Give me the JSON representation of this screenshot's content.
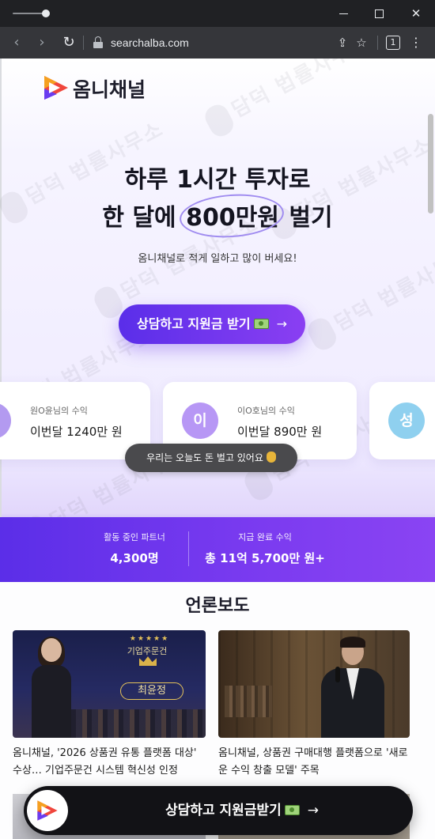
{
  "browser": {
    "url": "searchalba.com",
    "tab_count": "1"
  },
  "brand": {
    "name": "옴니채널"
  },
  "watermark": {
    "text": "담덕 법률사무소"
  },
  "hero": {
    "line1": "하루 1시간 투자로",
    "line2_prefix": "한 달에 ",
    "line2_highlight": "800만원",
    "line2_suffix": " 벌기",
    "subtitle": "옴니채널로 적게 일하고 많이 버세요!",
    "cta_label": "상담하고 지원금 받기",
    "cta_arrow": "→"
  },
  "earnings": [
    {
      "avatar": "",
      "name": "원O윤님의 수익",
      "amount": "이번달 1240만 원"
    },
    {
      "avatar": "이",
      "name": "이O호님의 수익",
      "amount": "이번달 890만 원"
    },
    {
      "avatar": "성",
      "name": "",
      "amount": ""
    }
  ],
  "toast": {
    "text": "우리는 오늘도 돈 벌고 있어요"
  },
  "stats": {
    "partners_label": "활동 중인 파트너",
    "partners_value": "4,300명",
    "paid_label": "지급 완료 수익",
    "paid_value": "총 11억 5,700만 원+"
  },
  "press": {
    "title": "언론보도",
    "items": [
      {
        "caption": "옴니채널, '2026 상품권 유통 플랫폼 대상' 수상… 기업주문건 시스템 혁신성 인정",
        "image_banner": "기업주문건",
        "image_name": "최윤정"
      },
      {
        "caption": "옴니채널, 상품권 구매대행 플랫폼으로 '새로운 수익 창출 모델' 주목"
      }
    ]
  },
  "floating_cta": {
    "label": "상담하고 지원금받기",
    "arrow": "→"
  },
  "colors": {
    "accent_start": "#5a2ee9",
    "accent_end": "#8a3ff2",
    "logo_red": "#f0463c",
    "logo_orange": "#f5a020",
    "logo_purple": "#6a3cf0"
  },
  "icons": {
    "back": "arrow-left-icon",
    "forward": "arrow-right-icon",
    "reload": "reload-icon",
    "lock": "lock-icon",
    "share": "share-icon",
    "bookmark": "star-icon",
    "menu": "more-vert-icon",
    "money": "banknote-icon",
    "bag": "money-bag-icon"
  }
}
